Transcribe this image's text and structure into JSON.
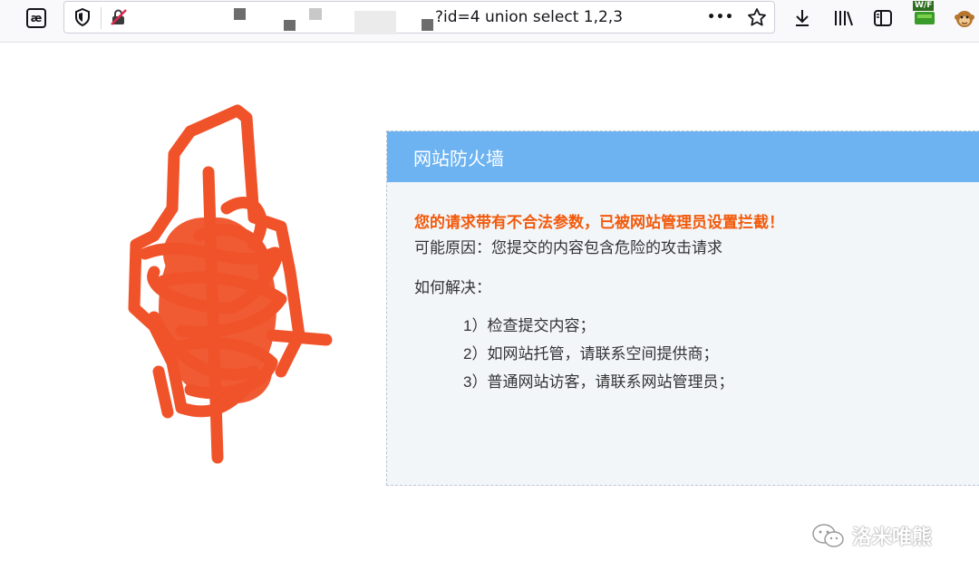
{
  "browser": {
    "url_visible_suffix": "?id=4 union select 1,2,3",
    "toolbar_icons": [
      "reader-view-icon",
      "tracking-protection-shield-icon",
      "insecure-lock-icon",
      "page-actions-menu-icon",
      "bookmark-star-icon",
      "downloads-icon",
      "library-icon",
      "sidebar-icon",
      "wappalyzer-extension-icon",
      "tampermonkey-extension-icon"
    ],
    "extension_badge": "W/F",
    "reader_glyph": "æ",
    "more_glyph": "•••"
  },
  "firewall": {
    "header_title": "网站防火墙",
    "warning_text": "您的请求带有不合法参数，已被网站管理员设置拦截！",
    "reason_text": "可能原因：您提交的内容包含危险的攻击请求",
    "howto_label": "如何解决：",
    "steps": [
      "1）检查提交内容；",
      "2）如网站托管，请联系空间提供商；",
      "3）普通网站访客，请联系网站管理员；"
    ]
  },
  "watermark": {
    "text": "洛米唯熊",
    "icon": "wechat-icon"
  },
  "colors": {
    "header_bg": "#6db3f2",
    "warning": "#f25a0c",
    "scribble": "#f0532a"
  }
}
